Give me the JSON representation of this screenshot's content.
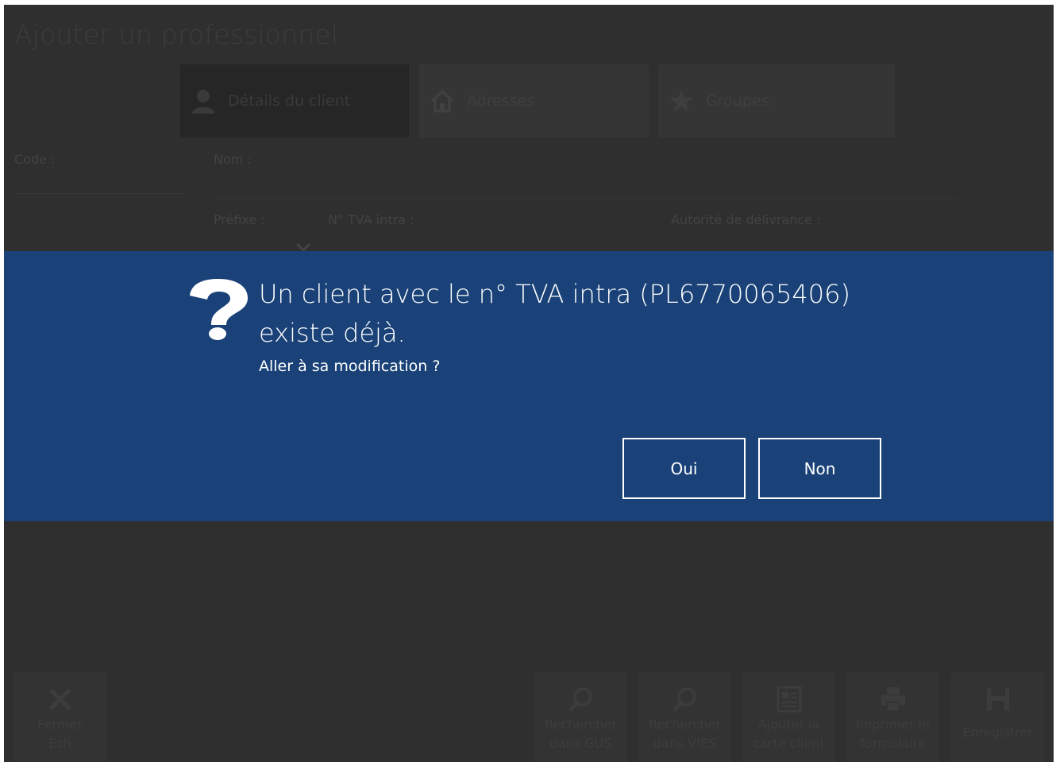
{
  "page": {
    "title": "Ajouter un professionnel"
  },
  "tabs": [
    {
      "label": "Détails du client",
      "icon": "person-icon",
      "active": true
    },
    {
      "label": "Adresses",
      "icon": "home-icon",
      "active": false
    },
    {
      "label": "Groupes",
      "icon": "star-icon",
      "active": false
    }
  ],
  "form": {
    "code_label": "Code :",
    "nom_label": "Nom :",
    "prefixe_label": "Préfixe :",
    "tva_label": "N° TVA intra :",
    "autorite_label": "Autorité de délivrance :"
  },
  "dialog": {
    "icon": "question-icon",
    "message": "Un client avec le n° TVA intra (PL6770065406) existe déjà.",
    "question": "Aller à sa modification ?",
    "yes_label": "Oui",
    "no_label": "Non",
    "background": "#1a4278"
  },
  "toolbar": {
    "close": {
      "line1": "Fermer",
      "line2": "Ech",
      "icon": "close-icon"
    },
    "gus": {
      "line1": "Rechercher",
      "line2": "dans GUS",
      "icon": "search-icon"
    },
    "vies": {
      "line1": "Rechercher",
      "line2": "dans VIES",
      "icon": "search-icon"
    },
    "card": {
      "line1": "Ajouter la",
      "line2": "carte client",
      "icon": "id-card-icon"
    },
    "print": {
      "line1": "Imprimer le",
      "line2": "formulaire",
      "icon": "printer-icon"
    },
    "save": {
      "label": "Enregistrer",
      "icon": "save-icon"
    }
  }
}
